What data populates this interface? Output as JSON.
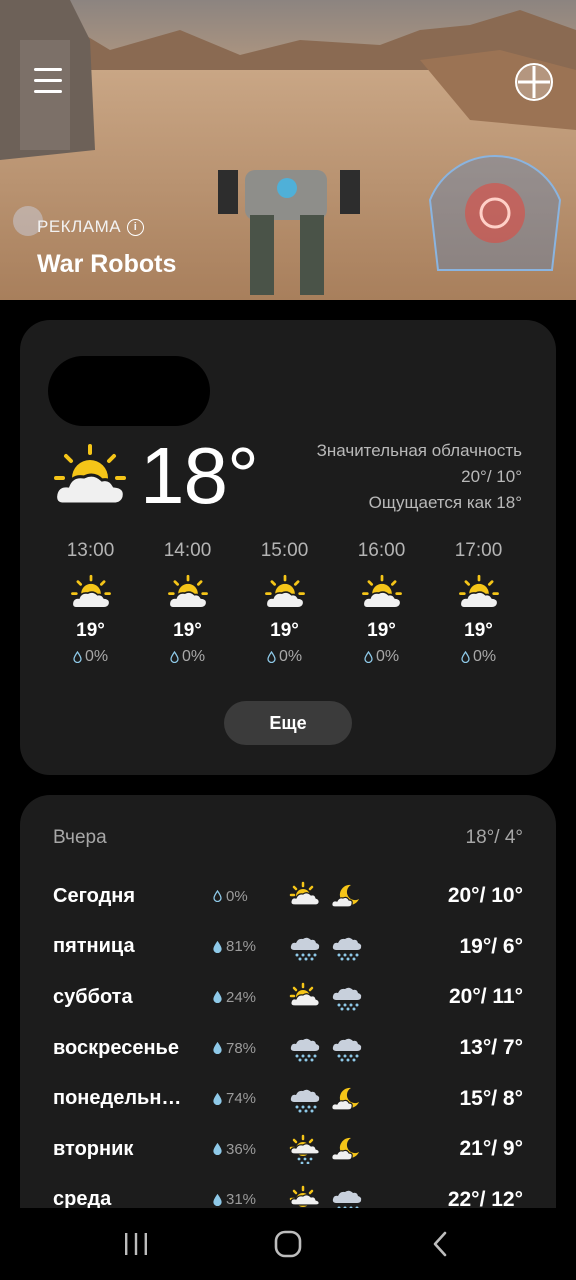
{
  "ad": {
    "label": "РЕКЛАМА",
    "title": "War Robots"
  },
  "current": {
    "temp": "18°",
    "condition": "Значительная облачность",
    "hi_lo": "20°/ 10°",
    "feels_like": "Ощущается как 18°",
    "icon": "partly-cloudy-sun-icon"
  },
  "hourly": [
    {
      "time": "13:00",
      "temp": "19°",
      "precip": "0%",
      "icon": "partly-cloudy-sun-icon"
    },
    {
      "time": "14:00",
      "temp": "19°",
      "precip": "0%",
      "icon": "partly-cloudy-sun-icon"
    },
    {
      "time": "15:00",
      "temp": "19°",
      "precip": "0%",
      "icon": "partly-cloudy-sun-icon"
    },
    {
      "time": "16:00",
      "temp": "19°",
      "precip": "0%",
      "icon": "partly-cloudy-sun-icon"
    },
    {
      "time": "17:00",
      "temp": "19°",
      "precip": "0%",
      "icon": "partly-cloudy-sun-icon"
    }
  ],
  "more_button": "Еще",
  "yesterday": {
    "label": "Вчера",
    "range": "18°/ 4°"
  },
  "daily": [
    {
      "name": "Сегодня",
      "precip": "0%",
      "day_icon": "partly-cloudy-sun-icon",
      "night_icon": "cloudy-moon-icon",
      "range": "20°/ 10°"
    },
    {
      "name": "пятница",
      "precip": "81%",
      "day_icon": "rain-cloud-icon",
      "night_icon": "rain-cloud-icon",
      "range": "19°/ 6°"
    },
    {
      "name": "суббота",
      "precip": "24%",
      "day_icon": "partly-cloudy-sun-icon",
      "night_icon": "rain-cloud-icon",
      "range": "20°/ 11°"
    },
    {
      "name": "воскресенье",
      "precip": "78%",
      "day_icon": "rain-cloud-icon",
      "night_icon": "rain-cloud-icon",
      "range": "13°/ 7°"
    },
    {
      "name": "понедельн…",
      "precip": "74%",
      "day_icon": "rain-cloud-icon",
      "night_icon": "cloudy-moon-icon",
      "range": "15°/ 8°"
    },
    {
      "name": "вторник",
      "precip": "36%",
      "day_icon": "sun-rain-cloud-icon",
      "night_icon": "cloudy-moon-icon",
      "range": "21°/ 9°"
    },
    {
      "name": "среда",
      "precip": "31%",
      "day_icon": "sun-rain-cloud-icon",
      "night_icon": "rain-cloud-icon",
      "range": "22°/ 12°"
    }
  ],
  "colors": {
    "card_bg": "#1c1c1c",
    "sun": "#f5c518",
    "cloud": "#f0f0f0",
    "rain_cloud": "#c8d0dc",
    "drop": "#8ec9e8"
  }
}
